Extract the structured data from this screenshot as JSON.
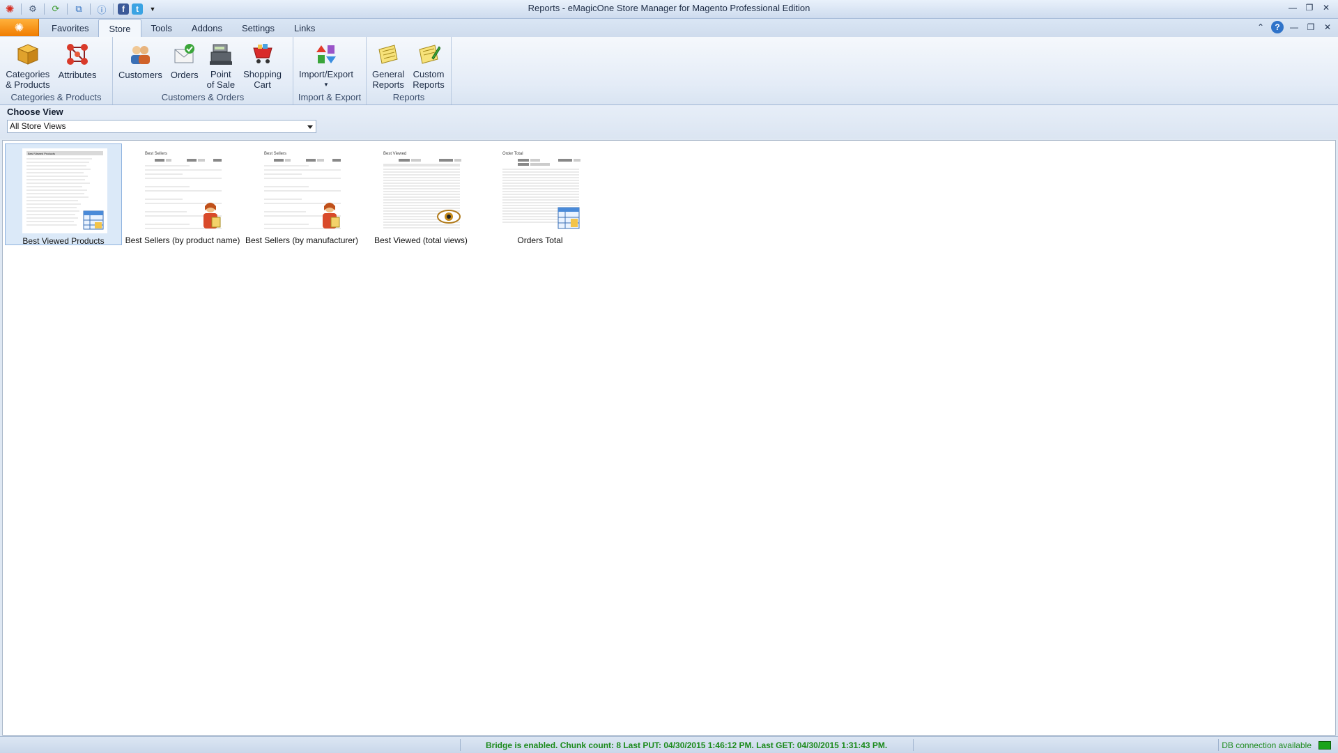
{
  "window": {
    "title": "Reports - eMagicOne Store Manager for Magento Professional Edition"
  },
  "quick_access": [
    "app-icon",
    "gear-icon",
    "refresh-icon",
    "windows-icon",
    "help-icon",
    "facebook-icon",
    "twitter-icon",
    "dropdown-icon"
  ],
  "tabs": [
    {
      "label": "Favorites"
    },
    {
      "label": "Store"
    },
    {
      "label": "Tools"
    },
    {
      "label": "Addons"
    },
    {
      "label": "Settings"
    },
    {
      "label": "Links"
    }
  ],
  "ribbon": {
    "groups": [
      {
        "label": "Categories & Products",
        "buttons": [
          {
            "line1": "Categories",
            "line2": "& Products",
            "icon": "box-icon"
          },
          {
            "line1": "Attributes",
            "line2": "",
            "icon": "attributes-icon"
          }
        ]
      },
      {
        "label": "Customers & Orders",
        "buttons": [
          {
            "line1": "Customers",
            "line2": "",
            "icon": "customers-icon"
          },
          {
            "line1": "Orders",
            "line2": "",
            "icon": "orders-icon"
          },
          {
            "line1": "Point",
            "line2": "of Sale",
            "icon": "cash-register-icon"
          },
          {
            "line1": "Shopping",
            "line2": "Cart",
            "icon": "shopping-cart-icon"
          }
        ]
      },
      {
        "label": "Import & Export",
        "buttons": [
          {
            "line1": "Import/Export",
            "line2": "",
            "icon": "import-export-icon"
          }
        ]
      },
      {
        "label": "Reports",
        "buttons": [
          {
            "line1": "General",
            "line2": "Reports",
            "icon": "general-reports-icon"
          },
          {
            "line1": "Custom",
            "line2": "Reports",
            "icon": "custom-reports-icon"
          }
        ]
      }
    ]
  },
  "choose_view": {
    "title": "Choose View",
    "selected": "All Store Views"
  },
  "reports": [
    {
      "label": "Best Viewed Products",
      "heading": "Best Viewed Products",
      "badge": "table-icon"
    },
    {
      "label": "Best Sellers (by product name)",
      "heading": "Best Sellers",
      "badge": "person-icon"
    },
    {
      "label": "Best Sellers (by manufacturer)",
      "heading": "Best Sellers",
      "badge": "person-icon"
    },
    {
      "label": "Best Viewed (total views)",
      "heading": "Best Viewed",
      "badge": "eye-icon"
    },
    {
      "label": "Orders Total",
      "heading": "Order Total",
      "badge": "chart-icon"
    }
  ],
  "status": {
    "message": "Bridge is enabled. Chunk count: 8 Last PUT: 04/30/2015 1:46:12 PM. Last GET: 04/30/2015 1:31:43 PM.",
    "db": "DB connection available"
  },
  "colors": {
    "accent_orange": "#f07c00",
    "status_green": "#1b8a1b",
    "selection": "#dbe9f8"
  }
}
